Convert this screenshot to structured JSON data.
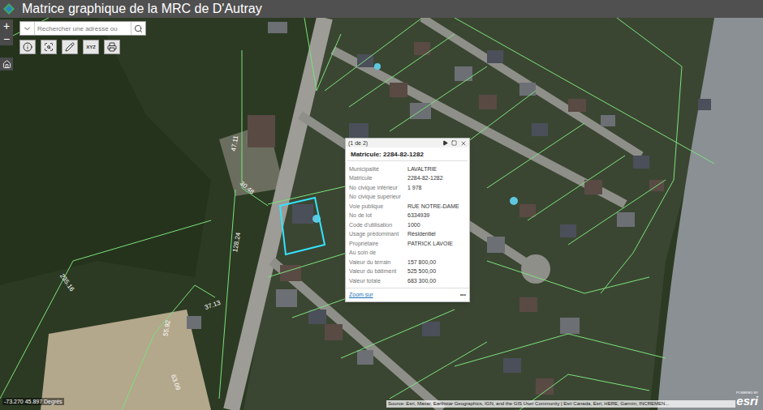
{
  "header": {
    "title": "Matrice graphique de la MRC de D'Autray"
  },
  "toolbar": {
    "zoom_in": "+",
    "zoom_out": "−",
    "search": {
      "placeholder": "Rechercher une adresse ou"
    },
    "coordinate_tool_label": "XYZ"
  },
  "popup": {
    "pager": "(1 de 2)",
    "title": "Matricule: 2284-82-1282",
    "fields": [
      {
        "label": "Municipalité",
        "value": "LAVALTRIE"
      },
      {
        "label": "Matricule",
        "value": "2284-82-1282"
      },
      {
        "label": "No civique inférieur",
        "value": "1 978"
      },
      {
        "label": "No civique supérieur",
        "value": ""
      },
      {
        "label": "Voie publique",
        "value": "RUE NOTRE-DAME"
      },
      {
        "label": "No de lot",
        "value": "6334939"
      },
      {
        "label": "Code d'utilisation",
        "value": "1000"
      },
      {
        "label": "Usage prédominant",
        "value": "Résidentiel"
      },
      {
        "label": "Propriétaire",
        "value": "PATRICK LAVOIE"
      },
      {
        "label": "Au soin de",
        "value": ""
      },
      {
        "label": "Valeur du terrain",
        "value": "157 800,00"
      },
      {
        "label": "Valeur du bâtiment",
        "value": "525 500,00"
      },
      {
        "label": "Valeur totale",
        "value": "683 300,00"
      }
    ],
    "zoom_link": "Zoom sur",
    "more": "•••"
  },
  "map_labels": [
    "47.11",
    "30.48",
    "128.24",
    "235.16",
    "37.13",
    "55.92",
    "63.09"
  ],
  "coordinates": "-73.270 45.897 Degrés",
  "attribution": "Source: Esri, Maxar, Earthstar Geographics, IGN, and the GIS User Community | Esri Canada, Esri, HERE, Garmin, INCREMEN...",
  "powered_by": {
    "small": "POWERED BY",
    "brand": "esri"
  }
}
